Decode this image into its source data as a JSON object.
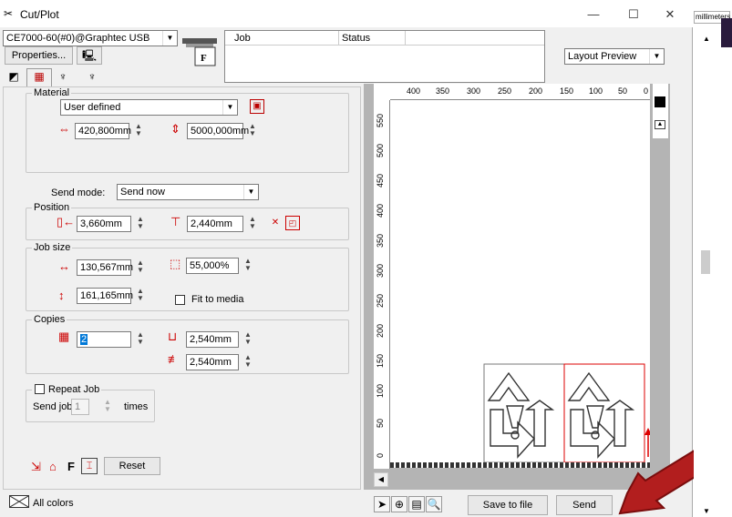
{
  "window": {
    "title": "Cut/Plot",
    "minimize": "—",
    "maximize": "☐",
    "close": "✕"
  },
  "device": {
    "selected": "CE7000-60(#0)@Graphtec USB",
    "properties_label": "Properties..."
  },
  "job_table": {
    "headers": [
      "Job",
      "Status"
    ]
  },
  "layout_combo": {
    "selected": "Layout Preview"
  },
  "material": {
    "group_label": "Material",
    "selected": "User defined",
    "width": "420,800mm",
    "height": "5000,000mm"
  },
  "send_mode": {
    "label": "Send mode:",
    "selected": "Send now"
  },
  "position": {
    "group_label": "Position",
    "x": "3,660mm",
    "y": "2,440mm"
  },
  "job_size": {
    "group_label": "Job size",
    "width": "130,567mm",
    "height": "161,165mm",
    "scale": "55,000%",
    "fit_label": "Fit to media"
  },
  "copies": {
    "group_label": "Copies",
    "count": "2",
    "spacing_x": "2,540mm",
    "spacing_y": "2,540mm"
  },
  "repeat_job": {
    "group_label": "Repeat Job",
    "send_label": "Send job",
    "count": "1",
    "times_label": "times"
  },
  "reset_label": "Reset",
  "ruler": {
    "top": [
      "400",
      "350",
      "300",
      "250",
      "200",
      "150",
      "100",
      "50",
      "0"
    ],
    "left": [
      "550",
      "500",
      "450",
      "400",
      "350",
      "300",
      "250",
      "200",
      "150",
      "100",
      "50",
      "0"
    ]
  },
  "bottom": {
    "all_colors": "All colors",
    "save_to_file": "Save to file",
    "send": "Send"
  },
  "side": {
    "units": "millimeters"
  },
  "colors": {
    "accent": "#cc0000",
    "arrow": "#b21e1e",
    "selection": "#0078d7"
  },
  "icons": [
    "plotter-icon",
    "material-icon",
    "tab-layout-icon",
    "tab-grid-icon",
    "tab-pen-icon",
    "tab-pen-plus-icon",
    "width-arrows-icon",
    "height-arrows-icon",
    "position-x-icon",
    "position-y-icon",
    "copies-grid-icon",
    "pointer-icon",
    "zoom-in-icon",
    "page-icon",
    "zoom-fit-icon"
  ]
}
